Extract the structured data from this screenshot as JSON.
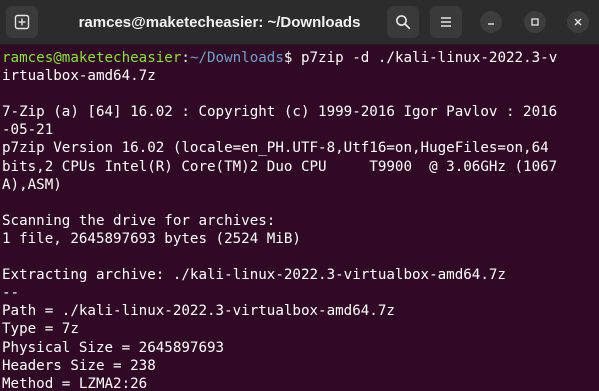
{
  "window": {
    "title": "ramces@maketecheasier: ~/Downloads"
  },
  "prompt": {
    "user_host": "ramces@maketecheasier",
    "colon": ":",
    "path": "~/Downloads",
    "dollar": "$ ",
    "command_part1": "p7zip -d ./kali-linux-2022.3-v",
    "command_part2": "irtualbox-amd64.7z"
  },
  "output": [
    "",
    "7-Zip (a) [64] 16.02 : Copyright (c) 1999-2016 Igor Pavlov : 2016",
    "-05-21",
    "p7zip Version 16.02 (locale=en_PH.UTF-8,Utf16=on,HugeFiles=on,64",
    "bits,2 CPUs Intel(R) Core(TM)2 Duo CPU     T9900  @ 3.06GHz (1067",
    "A),ASM)",
    "",
    "Scanning the drive for archives:",
    "1 file, 2645897693 bytes (2524 MiB)",
    "",
    "Extracting archive: ./kali-linux-2022.3-virtualbox-amd64.7z",
    "--",
    "Path = ./kali-linux-2022.3-virtualbox-amd64.7z",
    "Type = 7z",
    "Physical Size = 2645897693",
    "Headers Size = 238",
    "Method = LZMA2:26"
  ]
}
